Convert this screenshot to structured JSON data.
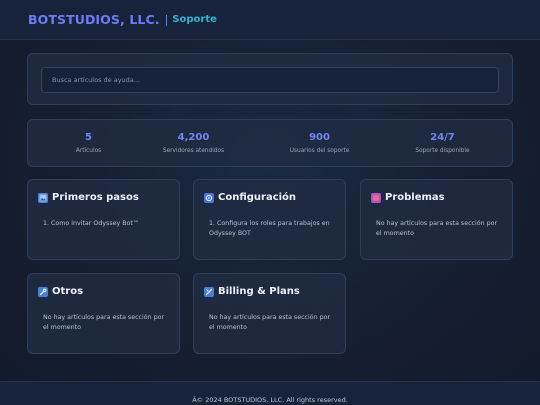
{
  "header": {
    "brand": "BOTSTUDIOS, LLC.",
    "separator": "|",
    "section": "Soporte"
  },
  "search": {
    "placeholder": "Busca artículos de ayuda..."
  },
  "stats": [
    {
      "value": "5",
      "label": "Artículos"
    },
    {
      "value": "4,200",
      "label": "Servidores atendidos"
    },
    {
      "value": "900",
      "label": "Usuarios del soporte"
    },
    {
      "value": "24/7",
      "label": "Soporte disponible"
    }
  ],
  "cards": [
    {
      "title": "Primeros pasos",
      "icon": "image-icon",
      "icon_color": "#4d7fd9",
      "body": "1. Como invitar Odyssey Bot™"
    },
    {
      "title": "Configuración",
      "icon": "gear-icon",
      "icon_color": "#4a72d8",
      "body": "1. Configura los roles para trabajos en Odyssey BOT"
    },
    {
      "title": "Problemas",
      "icon": "alert-icon",
      "icon_color": "#b050c8",
      "body": "No hay artículos para esta sección por el momento"
    },
    {
      "title": "Otros",
      "icon": "wrench-icon",
      "icon_color": "#4b7edb",
      "body": "No hay artículos para esta sección por el momento"
    },
    {
      "title": "Billing & Plans",
      "icon": "card-icon",
      "icon_color": "#4b7edb",
      "body": "No hay artículos para esta sección por el momento"
    }
  ],
  "footer": {
    "text": "Â© 2024 BOTSTUDIOS, LLC. All rights reserved."
  }
}
